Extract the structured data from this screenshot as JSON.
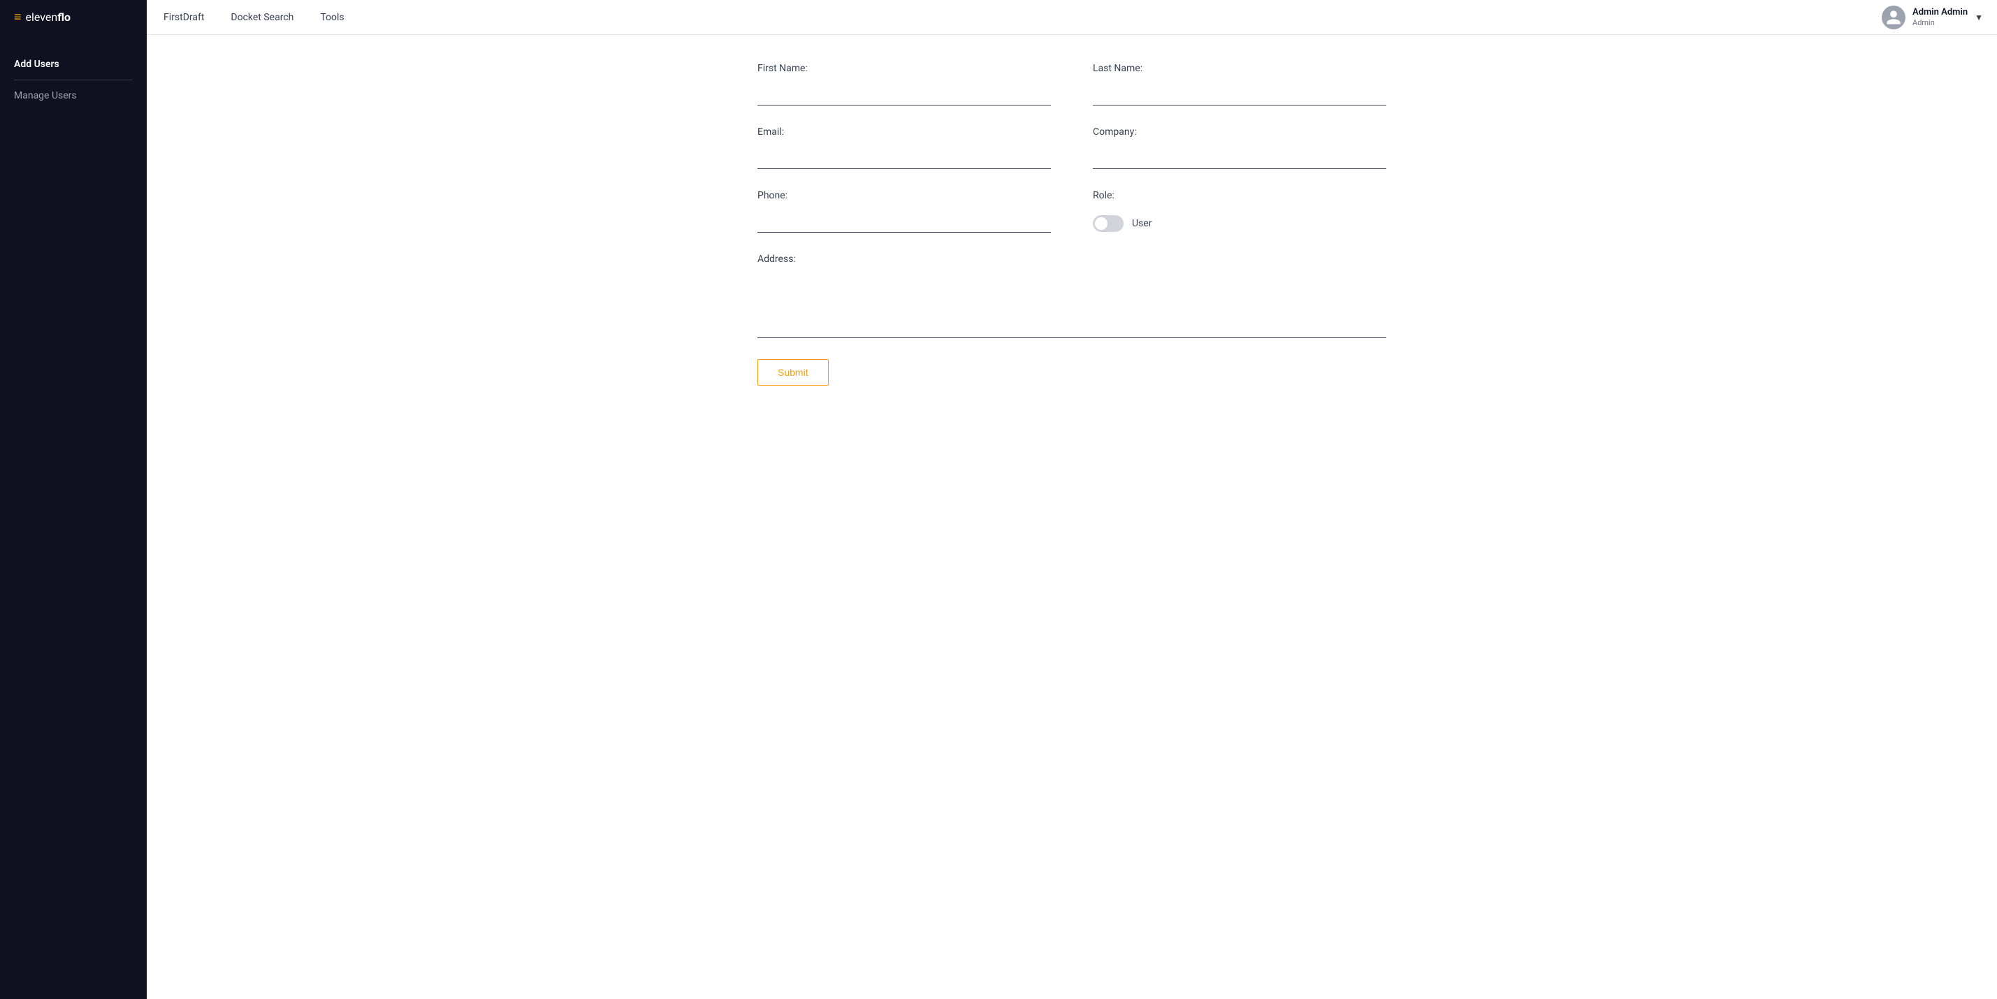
{
  "app": {
    "logo_prefix": "≡ eleven",
    "logo_suffix": "flo"
  },
  "nav": {
    "links": [
      {
        "label": "FirstDraft",
        "id": "first-draft"
      },
      {
        "label": "Docket Search",
        "id": "docket-search"
      },
      {
        "label": "Tools",
        "id": "tools"
      }
    ]
  },
  "user": {
    "name": "Admin Admin",
    "role": "Admin",
    "chevron": "▼"
  },
  "sidebar": {
    "items": [
      {
        "label": "Add Users",
        "type": "primary"
      },
      {
        "label": "Manage Users",
        "type": "secondary"
      }
    ]
  },
  "form": {
    "first_name_label": "First Name:",
    "last_name_label": "Last Name:",
    "email_label": "Email:",
    "company_label": "Company:",
    "phone_label": "Phone:",
    "role_label": "Role:",
    "role_value": "User",
    "address_label": "Address:",
    "submit_label": "Submit"
  }
}
